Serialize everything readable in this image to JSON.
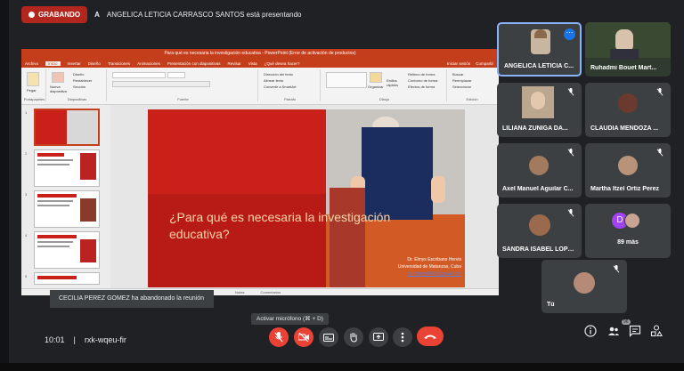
{
  "recording": {
    "label": "GRABANDO"
  },
  "presenter": {
    "icon": "A",
    "text": "ANGELICA LETICIA CARRASCO SANTOS está presentando"
  },
  "ppt": {
    "title": "Para qué es necesaria la investigación educativa - PowerPoint (Error de activación de productos)",
    "tabs": [
      "Archivo",
      "Inicio",
      "Insertar",
      "Diseño",
      "Transiciones",
      "Animaciones",
      "Presentación con diapositivas",
      "Revisar",
      "Vista",
      "¿Qué desea hacer?"
    ],
    "share": [
      "Iniciar sesión",
      "Compartir"
    ],
    "ribbon_groups": [
      "Portapapeles",
      "Diapositivas",
      "Fuente",
      "Párrafo",
      "Dibujo",
      "Edición"
    ],
    "ribbon_items": {
      "paste": "Pegar",
      "new_slide": "Nueva diapositiva",
      "layout": "Diseño",
      "reset": "Restablecer",
      "section": "Sección",
      "text_direction": "Dirección del texto",
      "align_text": "Alinear texto",
      "convert_smartart": "Convertir a SmartArt",
      "arrange": "Organizar",
      "quick_styles": "Estilos rápidos",
      "shape_fill": "Relleno de forma",
      "shape_outline": "Contorno de forma",
      "shape_effects": "Efectos de forma",
      "find": "Buscar",
      "replace": "Reemplazar",
      "select": "Seleccionar"
    },
    "status": [
      "Notas",
      "Comentarios"
    ],
    "slide": {
      "title": "¿Para qué es necesaria la investigación educativa?",
      "author": "Dr. Elmys Escribano Hervis",
      "institution": "Universidad de Matanzas, Cuba",
      "email": "escribano2003@gmail.com"
    },
    "thumb_numbers": [
      "1",
      "2",
      "3",
      "4",
      "5"
    ]
  },
  "participants": [
    {
      "name": "ANGELICA LETICIA C...",
      "active": true
    },
    {
      "name": "Ruhadmi Bouet Mart..."
    },
    {
      "name": "LILIANA ZUÑIGA DA..."
    },
    {
      "name": "CLAUDIA MENDOZA ..."
    },
    {
      "name": "Axel Manuel Aguilar C..."
    },
    {
      "name": "Martha Itzel Ortiz Perez"
    },
    {
      "name": "SANDRA ISABEL LOPE..."
    },
    {
      "name": "89 más",
      "initial": "D"
    },
    {
      "name": "Tú"
    }
  ],
  "toast": "CECILIA PEREZ GOMEZ ha abandonado la reunión",
  "tooltip": "Activar micrófono (⌘ + D)",
  "meeting": {
    "time": "10:01",
    "separator": "|",
    "code": "rxk-wqeu-fir"
  },
  "people_count": "96",
  "colors": {
    "accent": "#1a73e8",
    "recording": "#b3261e",
    "hangup": "#ea4335",
    "ppt_brand": "#c43e1c"
  },
  "icons": [
    "microphone-off-icon",
    "camera-off-icon",
    "captions-icon",
    "raise-hand-icon",
    "present-icon",
    "more-options-icon",
    "hang-up-icon",
    "info-icon",
    "people-icon",
    "chat-icon",
    "activities-icon"
  ]
}
